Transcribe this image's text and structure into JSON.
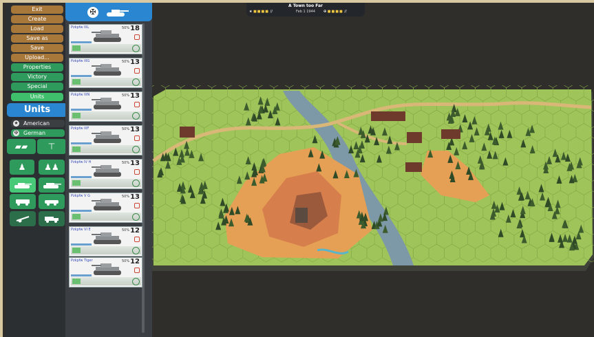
{
  "menu": {
    "buttons": [
      {
        "label": "Exit",
        "style": "brown"
      },
      {
        "label": "Create",
        "style": "brown"
      },
      {
        "label": "Load",
        "style": "brown"
      },
      {
        "label": "Save as",
        "style": "brown"
      },
      {
        "label": "Save",
        "style": "brown"
      },
      {
        "label": "Upload...",
        "style": "brown"
      },
      {
        "label": "Properties",
        "style": "green"
      },
      {
        "label": "Victory",
        "style": "green"
      },
      {
        "label": "Special",
        "style": "green"
      },
      {
        "label": "Units",
        "style": "active"
      }
    ]
  },
  "units_panel": {
    "header": "Units",
    "nations": [
      "American",
      "German"
    ],
    "selected_nation": "German",
    "categories": [
      "infantry-heavy-weapons",
      "machine-gun",
      "infantry-squad",
      "infantry-team",
      "tank-light",
      "tank-heavy",
      "halftrack",
      "armored-car",
      "artillery",
      "truck"
    ],
    "selected_category": "tank-light"
  },
  "unit_cards": [
    {
      "name": "Pzkpfw IIIL",
      "pct": "50%",
      "cost": "18"
    },
    {
      "name": "Pzkpfw IIIG",
      "pct": "50%",
      "cost": "13"
    },
    {
      "name": "Pzkpfw IIIN",
      "pct": "50%",
      "cost": "13"
    },
    {
      "name": "Pzkpfw IIIF",
      "pct": "50%",
      "cost": "13"
    },
    {
      "name": "Pzkpfw IV H",
      "pct": "50%",
      "cost": "13"
    },
    {
      "name": "Pzkpfw V G",
      "pct": "50%",
      "cost": "13"
    },
    {
      "name": "Pzkpfw VI E",
      "pct": "50%",
      "cost": "12"
    },
    {
      "name": "Pzkpfw Tiger",
      "pct": "50%",
      "cost": "12"
    }
  ],
  "scenario": {
    "title": "A Town too Far",
    "date": "Feb 1 1944",
    "left_pips": "■■■■",
    "right_pips": "■■■■",
    "left_marks": "//",
    "right_marks": "//"
  },
  "colors": {
    "grass": "#9fc45a",
    "orange_hill": "#e6a055",
    "high_hill": "#c86e45",
    "river": "#7d98a6",
    "road": "#d9b777",
    "accent": "#2a86d0"
  }
}
